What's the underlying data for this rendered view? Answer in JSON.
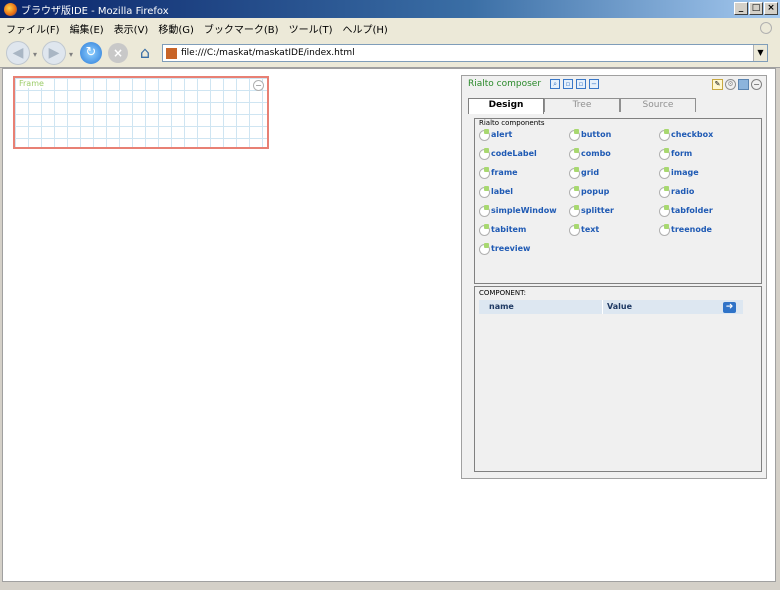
{
  "window": {
    "title": "ブラウザ版IDE - Mozilla Firefox",
    "buttons": {
      "minimize": "_",
      "maximize": "□",
      "close": "×"
    }
  },
  "menubar": {
    "items": [
      "ファイル(F)",
      "編集(E)",
      "表示(V)",
      "移動(G)",
      "ブックマーク(B)",
      "ツール(T)",
      "ヘルプ(H)"
    ]
  },
  "navbar": {
    "url": "file:///C:/maskat/maskatIDE/index.html"
  },
  "frame_widget": {
    "title": "Frame"
  },
  "composer": {
    "title": "Rialto composer",
    "tabs": [
      "Design",
      "Tree",
      "Source"
    ],
    "active_tab": "Design",
    "components_label": "Rialto components",
    "components": [
      "alert",
      "button",
      "checkbox",
      "codeLabel",
      "combo",
      "form",
      "frame",
      "grid",
      "image",
      "label",
      "popup",
      "radio",
      "simpleWindow",
      "splitter",
      "tabfolder",
      "tabitem",
      "text",
      "treenode",
      "treeview"
    ],
    "properties": {
      "label": "COMPONENT:",
      "columns": [
        "name",
        "Value"
      ]
    }
  },
  "colors": {
    "accent": "#1f5ab4",
    "frame_border": "#e88074",
    "composer_title": "#2b8a2b"
  }
}
